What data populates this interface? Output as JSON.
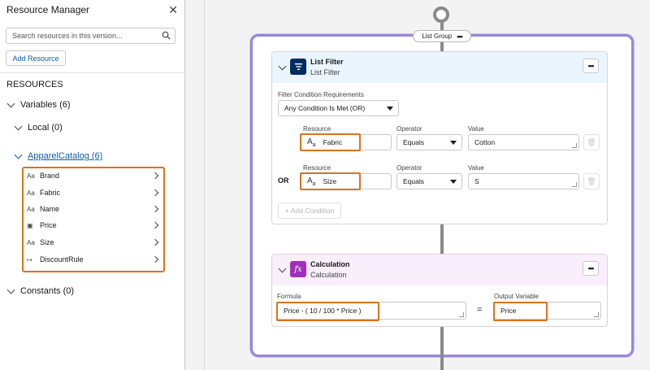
{
  "resource_manager": {
    "title": "Resource Manager",
    "close_icon": "close-icon",
    "search_placeholder": "Search resources in this version...",
    "add_resource_label": "Add Resource",
    "heading": "RESOURCES",
    "variables_label": "Variables (6)",
    "local_label": "Local (0)",
    "apparel_label": "ApparelCatalog (6)",
    "constants_label": "Constants (0)",
    "variables": [
      {
        "icon": "text-type-icon",
        "glyph": "Aa",
        "label": "Brand"
      },
      {
        "icon": "text-type-icon",
        "glyph": "Aa",
        "label": "Fabric"
      },
      {
        "icon": "text-type-icon",
        "glyph": "Aa",
        "label": "Name"
      },
      {
        "icon": "currency-type-icon",
        "glyph": "▣",
        "label": "Price"
      },
      {
        "icon": "text-type-icon",
        "glyph": "Aa",
        "label": "Size"
      },
      {
        "icon": "formula-type-icon",
        "glyph": "↦",
        "label": "DiscountRule"
      }
    ]
  },
  "canvas": {
    "group_label": "List Group",
    "list_filter": {
      "title": "List Filter",
      "subtitle": "List Filter",
      "requirements_label": "Filter Condition Requirements",
      "requirements_value": "Any Condition Is Met (OR)",
      "conditions": [
        {
          "resource_label": "Resource",
          "resource": "Fabric",
          "operator_label": "Operator",
          "operator": "Equals",
          "value_label": "Value",
          "value": "Cotton"
        },
        {
          "prefix": "OR",
          "resource_label": "Resource",
          "resource": "Size",
          "operator_label": "Operator",
          "operator": "Equals",
          "value_label": "Value",
          "value": "S"
        }
      ],
      "add_condition_label": "+ Add Condition"
    },
    "calculation": {
      "title": "Calculation",
      "subtitle": "Calculation",
      "formula_label": "Formula",
      "formula": "Price - ( 10 / 100 * Price )",
      "equals": "=",
      "output_label": "Output Variable",
      "output": "Price"
    },
    "colors": {
      "group_border": "#9a86d8",
      "highlight": "#d9731c",
      "list_filter_header": "#eaf5fe",
      "list_filter_icon": "#032d60",
      "calculation_header": "#f9eefc",
      "calculation_icon": "#9e2fba",
      "link": "#0b5cab"
    }
  }
}
